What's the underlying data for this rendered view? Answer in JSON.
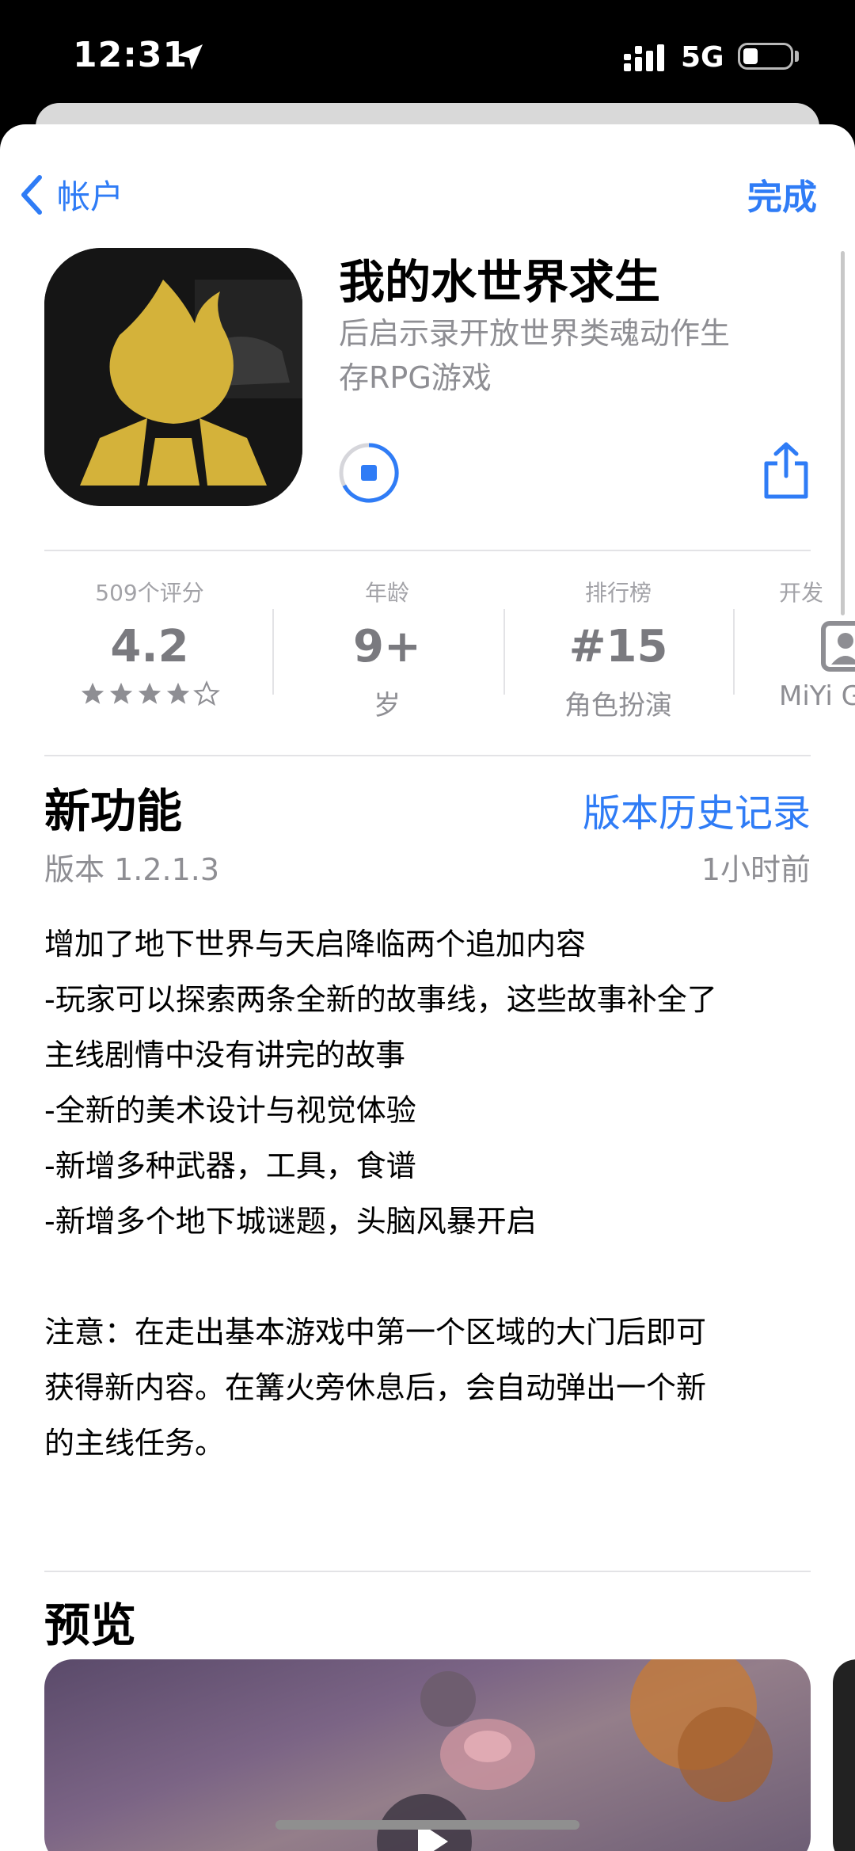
{
  "status_bar": {
    "time": "12:31",
    "network": "5G",
    "battery_level": 0.3
  },
  "nav": {
    "back_label": "帐户",
    "done_label": "完成"
  },
  "app": {
    "name": "我的水世界求生",
    "subtitle_line1": "后启示录开放世界类魂动作生",
    "subtitle_line2": "存RPG游戏"
  },
  "stats": {
    "ratings_label": "509个评分",
    "rating_value": "4.2",
    "rating_stars": 4,
    "age_label": "年龄",
    "age_value": "9+",
    "age_sub": "岁",
    "chart_label": "排行榜",
    "chart_value": "#15",
    "chart_sub": "角色扮演",
    "dev_label": "开发",
    "dev_sub": "MiYi G"
  },
  "whats_new": {
    "title": "新功能",
    "history_link": "版本历史记录",
    "version": "版本 1.2.1.3",
    "time_ago": "1小时前",
    "lines": [
      "增加了地下世界与天启降临两个追加内容",
      "-玩家可以探索两条全新的故事线，这些故事补全了",
      "主线剧情中没有讲完的故事",
      "-全新的美术设计与视觉体验",
      "-新增多种武器，工具，食谱",
      "-新增多个地下城谜题，头脑风暴开启",
      "",
      "注意：在走出基本游戏中第一个区域的大门后即可",
      "获得新内容。在篝火旁休息后，会自动弹出一个新",
      "的主线任务。"
    ]
  },
  "preview": {
    "title": "预览"
  },
  "colors": {
    "accent": "#2f7cf6",
    "secondary_text": "#8e8e93"
  }
}
